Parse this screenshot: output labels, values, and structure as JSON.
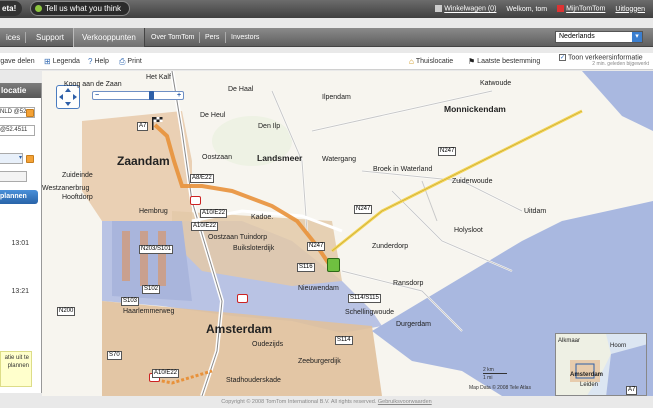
{
  "topbar": {
    "beta_tab": "eta!",
    "feedback": "Tell us what you think",
    "cart": "Winkelwagen (0)",
    "welcome": "Welkom, tom",
    "mytomtom": "MijnTomTom",
    "logout": "Uitloggen"
  },
  "nav": {
    "services": "ices",
    "support": "Support",
    "stores": "Verkooppunten",
    "about": "Over TomTom",
    "pers": "Pers",
    "investors": "Investors",
    "language": "Nederlands"
  },
  "toolbar": {
    "share": "rgave delen",
    "legend": "Legenda",
    "help": "Help",
    "print": "Print",
    "home": "Thuislocatie",
    "last_dest": "Laatste bestemming",
    "traffic": "Toon verkeersinformatie",
    "traffic_sub": "2 min. geleden bijgewerkt"
  },
  "left": {
    "header": "locatie",
    "from": "NLD @52.",
    "to": "@52.4511",
    "plan": "plannen",
    "time1": "13:01",
    "time2": "13:21",
    "note1": "atie uit te",
    "note2": "plannen"
  },
  "map": {
    "labels": {
      "amsterdam": "Amsterdam",
      "zaandam": "Zaandam",
      "landsmeer": "Landsmeer",
      "monnickendam": "Monnickendam",
      "kogaandezaan": "Koog aan de Zaan",
      "dehaal": "De Haal",
      "deheul": "De Heul",
      "denilp": "Den Ilp",
      "ilpendam": "Ilpendam",
      "katwoude": "Katwoude",
      "watergang": "Watergang",
      "broek": "Broek in Waterland",
      "zuiderwoude": "Zuiderwoude",
      "uitdam": "Uitdam",
      "holysloot": "Holysloot",
      "zunderdorp": "Zunderdorp",
      "nieuwendam": "Nieuwendam",
      "ransdorp": "Ransdorp",
      "schellingwoude": "Schellingwoude",
      "durgerdam": "Durgerdam",
      "oostzaan": "Oostzaan",
      "zuideinde": "Zuideinde",
      "westzanerbrug": "Westzanerbrug",
      "hooftdorp": "Hooftdorp",
      "hembrug": "Hembrug",
      "oostzaantuindorp": "Oostzaan Tuindorp",
      "buiksloterdijk": "Buiksloterdijk",
      "kadoelen": "Kadoe.",
      "haarlemmerweg": "Haarlemmerweg",
      "oudezijds": "Oudezijds",
      "stadhouderskade": "Stadhouderskade",
      "zeeburgerdijk": "Zeeburgerdijk",
      "hetkalf": "Het Kalf",
      "alkmaar": "Alkmaar",
      "hoorn": "Hoorn",
      "leiden": "Leiden",
      "amsterdam_mini": "Amsterdam"
    },
    "roads": {
      "a7": "A7",
      "a8": "A8/E22",
      "a10a": "A10/E22",
      "a10b": "A10/E22",
      "n203": "N203/S101",
      "s102": "S102",
      "s103": "S103",
      "n200": "N200",
      "n247a": "N247",
      "n247b": "N247",
      "n247c": "N247",
      "s116": "S116",
      "s114": "S114/S115",
      "s114b": "S114",
      "s70": "S70",
      "a10c": "A10/E22",
      "a7mini": "A7"
    },
    "scale_km": "2 km",
    "scale_mi": "1 mi",
    "mapdata": "Map Data © 2008 Tele Atlas"
  },
  "footer": {
    "copyright": "Copyright © 2008 TomTom International B.V. All rights reserved.",
    "terms": "Gebruiksvoorwaarden"
  },
  "colors": {
    "route": "#e8913a",
    "water": "#a9b8e0",
    "accent": "#2d5fa8"
  }
}
